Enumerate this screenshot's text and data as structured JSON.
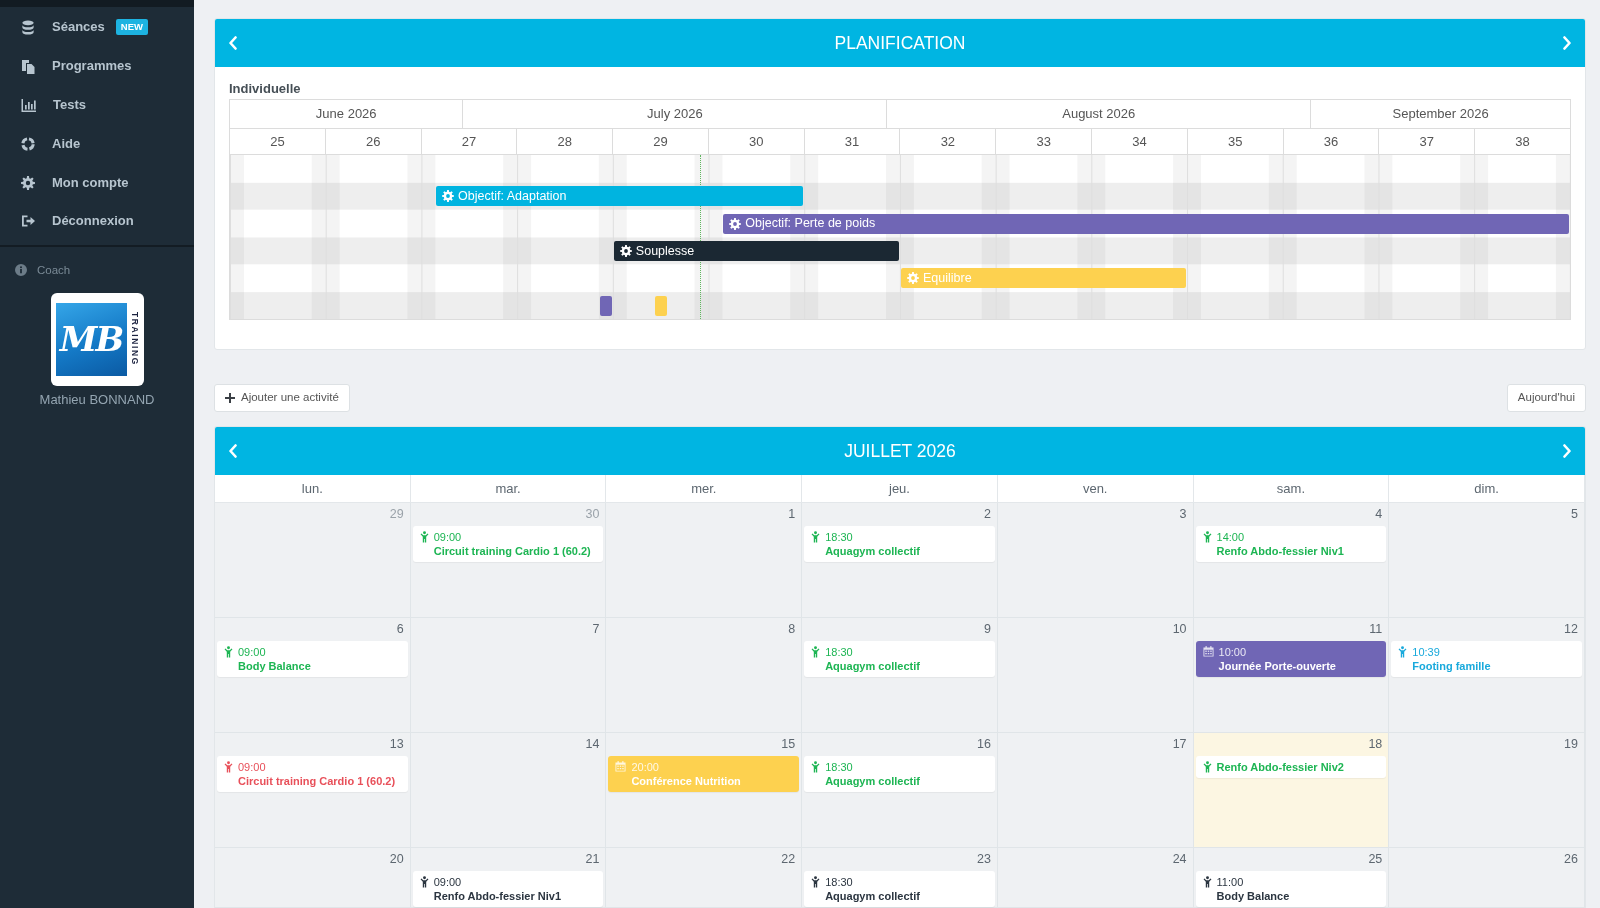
{
  "sidebar": {
    "items": [
      {
        "label": "Séances",
        "badge": "NEW"
      },
      {
        "label": "Programmes"
      },
      {
        "label": "Tests"
      },
      {
        "label": "Aide"
      },
      {
        "label": "Mon compte"
      },
      {
        "label": "Déconnexion"
      }
    ],
    "coach": {
      "role": "Coach",
      "logo": {
        "monogram": "MB",
        "tagline": "TRAINING"
      },
      "name": "Mathieu BONNAND"
    }
  },
  "planning": {
    "title": "PLANIFICATION",
    "group": "Individuelle",
    "months": [
      "June 2026",
      "July 2026",
      "August 2026",
      "September 2026"
    ],
    "weeks": [
      "25",
      "26",
      "27",
      "28",
      "29",
      "30",
      "31",
      "32",
      "33",
      "34",
      "35",
      "36",
      "37",
      "38"
    ],
    "rows": [
      {
        "items": [
          {
            "kind": "bar",
            "label": "Objectif: Adaptation",
            "color": "#00b4e0"
          }
        ]
      },
      {
        "items": [
          {
            "kind": "bar",
            "label": "Objectif: Perte de poids",
            "color": "#7066b5"
          }
        ]
      },
      {
        "items": [
          {
            "kind": "bar",
            "label": "Souplesse",
            "color": "#1b2833"
          }
        ]
      },
      {
        "items": [
          {
            "kind": "bar",
            "label": "Equilibre",
            "color": "#fdd14f"
          }
        ]
      },
      {
        "items": [
          {
            "kind": "marker",
            "color": "#7066b5"
          },
          {
            "kind": "marker",
            "color": "#fdd14f"
          }
        ]
      }
    ]
  },
  "toolbar": {
    "add_button": "Ajouter une activité",
    "today_button": "Aujourd'hui"
  },
  "calendar": {
    "title": "JUILLET 2026",
    "weekdays": [
      "lun.",
      "mar.",
      "mer.",
      "jeu.",
      "ven.",
      "sam.",
      "dim."
    ],
    "weeks": [
      [
        {
          "day": "29",
          "other_month": true,
          "today": false
        },
        {
          "day": "30",
          "other_month": true,
          "today": false,
          "events": [
            {
              "kind": "session",
              "time": "09:00",
              "title": "Circuit training Cardio 1 (60.2)",
              "color": "#1db553"
            }
          ]
        },
        {
          "day": "1",
          "other_month": false,
          "today": false
        },
        {
          "day": "2",
          "other_month": false,
          "today": false,
          "events": [
            {
              "kind": "session",
              "time": "18:30",
              "title": "Aquagym collectif",
              "color": "#1db553"
            }
          ]
        },
        {
          "day": "3",
          "other_month": false,
          "today": false
        },
        {
          "day": "4",
          "other_month": false,
          "today": false,
          "events": [
            {
              "kind": "session",
              "time": "14:00",
              "title": "Renfo Abdo-fessier Niv1",
              "color": "#1db553"
            }
          ]
        },
        {
          "day": "5",
          "other_month": false,
          "today": false
        }
      ],
      [
        {
          "day": "6",
          "other_month": false,
          "today": false,
          "events": [
            {
              "kind": "session",
              "time": "09:00",
              "title": "Body Balance",
              "color": "#1db553"
            }
          ]
        },
        {
          "day": "7",
          "other_month": false,
          "today": false
        },
        {
          "day": "8",
          "other_month": false,
          "today": false
        },
        {
          "day": "9",
          "other_month": false,
          "today": false,
          "events": [
            {
              "kind": "session",
              "time": "18:30",
              "title": "Aquagym collectif",
              "color": "#1db553"
            }
          ]
        },
        {
          "day": "10",
          "other_month": false,
          "today": false
        },
        {
          "day": "11",
          "other_month": false,
          "today": false,
          "events": [
            {
              "kind": "event",
              "time": "10:00",
              "title": "Journée Porte-ouverte",
              "color": "#7066b5"
            }
          ]
        },
        {
          "day": "12",
          "other_month": false,
          "today": false,
          "events": [
            {
              "kind": "session",
              "time": "10:39",
              "title": "Footing famille",
              "color": "#18a9dc"
            }
          ]
        }
      ],
      [
        {
          "day": "13",
          "other_month": false,
          "today": false,
          "events": [
            {
              "kind": "session",
              "time": "09:00",
              "title": "Circuit training Cardio 1 (60.2)",
              "color": "#e8505a"
            }
          ]
        },
        {
          "day": "14",
          "other_month": false,
          "today": false
        },
        {
          "day": "15",
          "other_month": false,
          "today": false,
          "events": [
            {
              "kind": "event",
              "time": "20:00",
              "title": "Conférence Nutrition",
              "color": "#fdd14f"
            }
          ]
        },
        {
          "day": "16",
          "other_month": false,
          "today": false,
          "events": [
            {
              "kind": "session",
              "time": "18:30",
              "title": "Aquagym collectif",
              "color": "#1db553"
            }
          ]
        },
        {
          "day": "17",
          "other_month": false,
          "today": false
        },
        {
          "day": "18",
          "other_month": false,
          "today": true,
          "events": [
            {
              "kind": "session",
              "title": "Renfo Abdo-fessier Niv2",
              "color": "#1db553"
            }
          ]
        },
        {
          "day": "19",
          "other_month": false,
          "today": false
        }
      ],
      [
        {
          "day": "20",
          "other_month": false,
          "today": false
        },
        {
          "day": "21",
          "other_month": false,
          "today": false,
          "events": [
            {
              "kind": "session",
              "time": "09:00",
              "title": "Renfo Abdo-fessier Niv1",
              "color": "#2b3540"
            }
          ]
        },
        {
          "day": "22",
          "other_month": false,
          "today": false
        },
        {
          "day": "23",
          "other_month": false,
          "today": false,
          "events": [
            {
              "kind": "session",
              "time": "18:30",
              "title": "Aquagym collectif",
              "color": "#2b3540"
            }
          ]
        },
        {
          "day": "24",
          "other_month": false,
          "today": false
        },
        {
          "day": "25",
          "other_month": false,
          "today": false,
          "events": [
            {
              "kind": "session",
              "time": "11:00",
              "title": "Body Balance",
              "color": "#2b3540"
            }
          ]
        },
        {
          "day": "26",
          "other_month": false,
          "today": false
        }
      ]
    ]
  }
}
